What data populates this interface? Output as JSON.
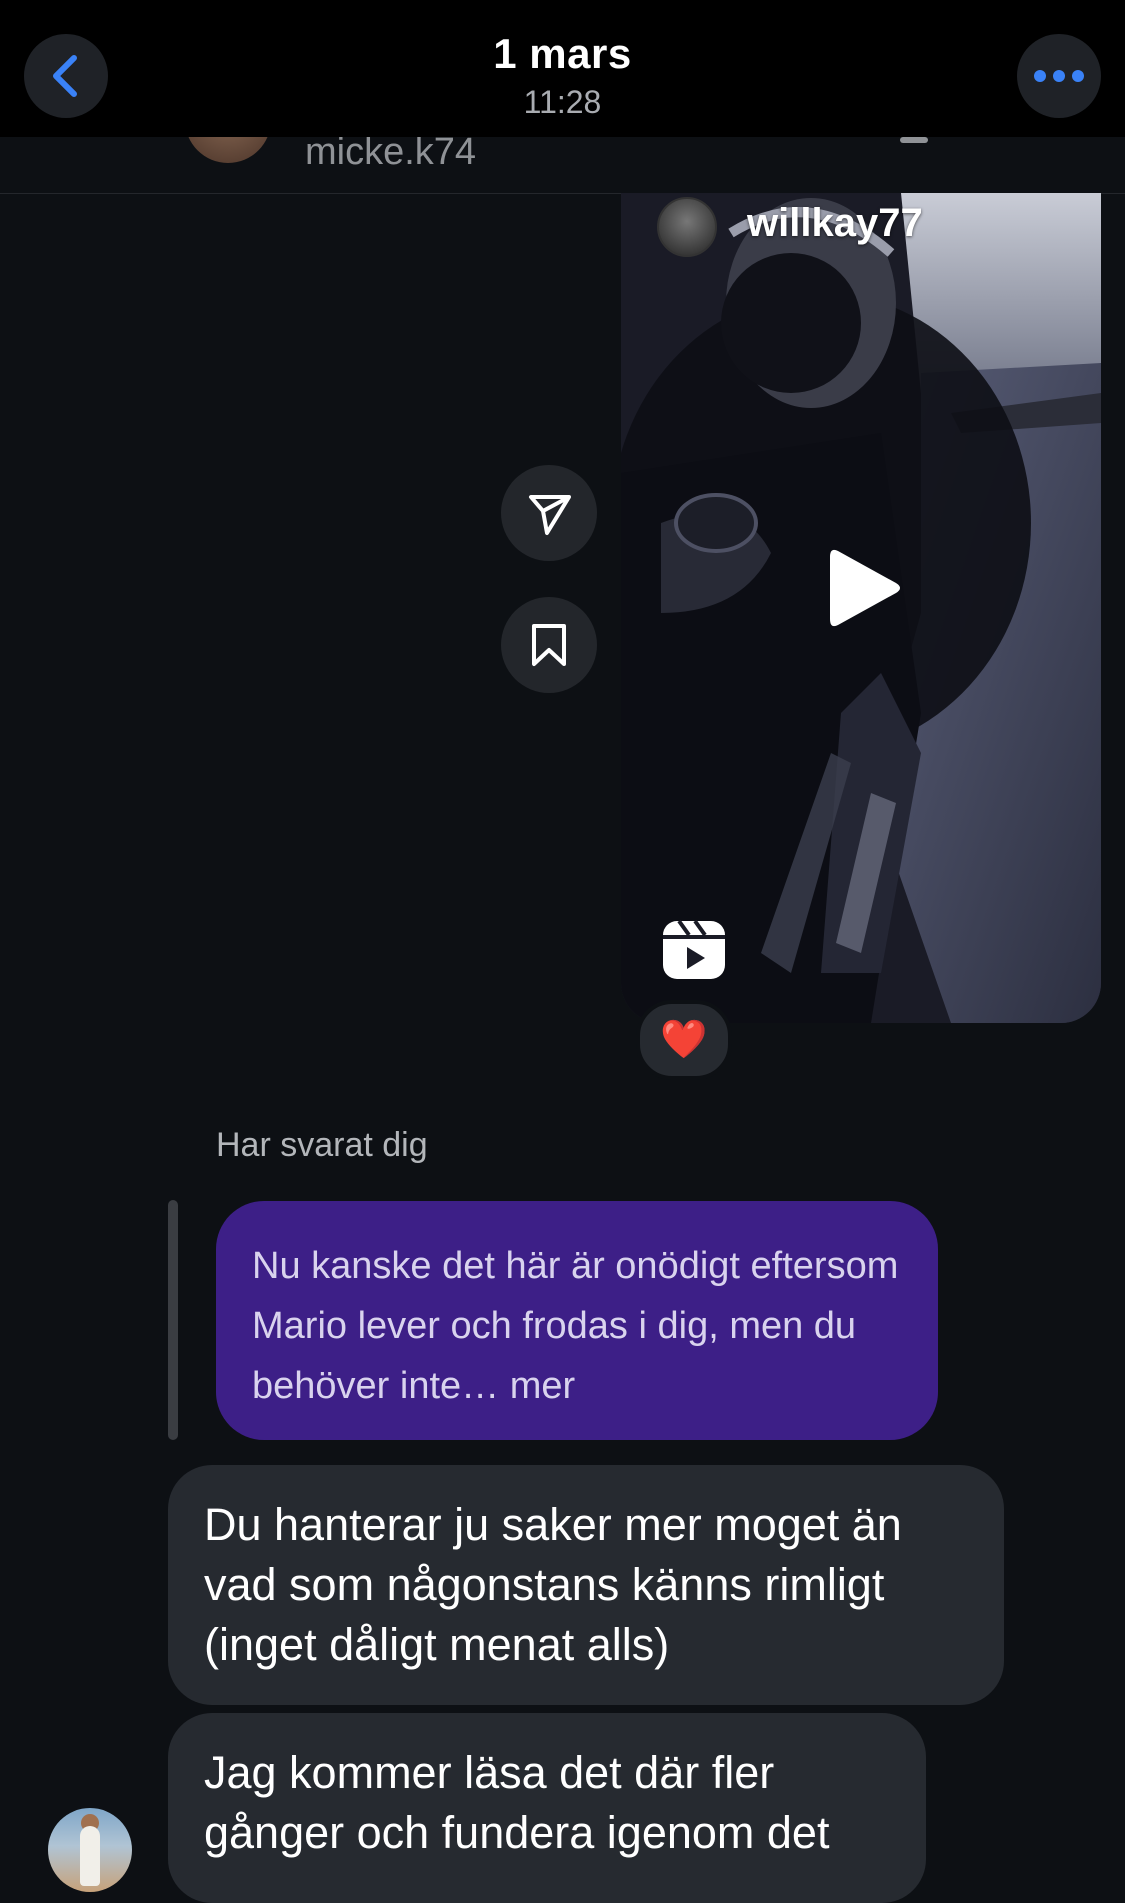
{
  "top_bar": {
    "date": "1 mars",
    "time": "11:28"
  },
  "header": {
    "username": "micke.k74"
  },
  "reel": {
    "username": "willkay77"
  },
  "reaction": {
    "emoji": "❤️"
  },
  "thread": {
    "replied_label": "Har svarat dig",
    "quoted_message": "Nu kanske det här är onödigt eftersom Mario lever och frodas i dig, men du behöver inte… mer",
    "messages": [
      "Du hanterar ju saker mer moget än vad som någonstans känns rimligt (inget dåligt menat alls)",
      "Jag kommer läsa det där fler gånger och fundera igenom det"
    ]
  },
  "colors": {
    "accent_blue": "#3a82f7",
    "quoted_bubble": "#3d1f87",
    "bubble": "#262a30",
    "background": "#0d1014"
  }
}
